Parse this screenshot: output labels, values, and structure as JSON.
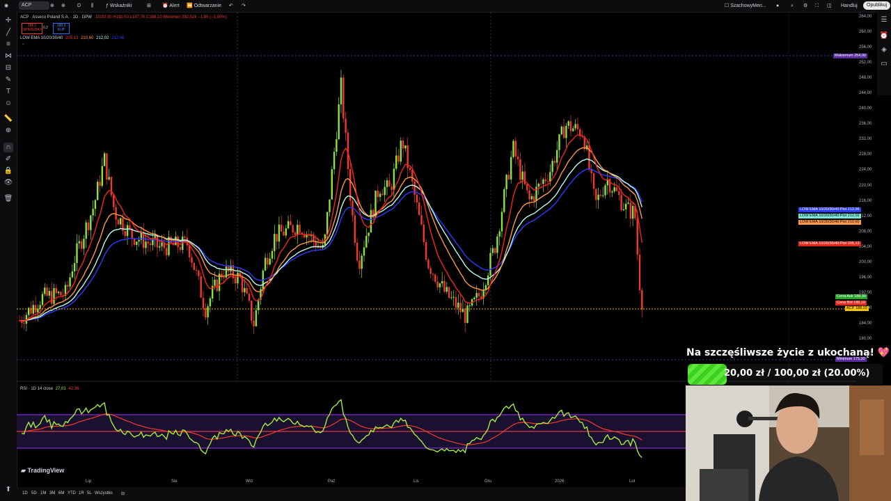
{
  "topbar": {
    "symbol": "ACP",
    "interval": "D",
    "indicators_label": "Wskaźniki",
    "alert_label": "Alert",
    "replay_label": "Odtwarzanie",
    "layout_label": "SzachowyMen...",
    "trade_label": "Handluj",
    "publish_label": "Opublikuj"
  },
  "legend": {
    "title": "ACP · Asseco Poland S.A. · 1D · GPW",
    "ohlc": "O192,00 H192,50 L187,70 C188,10 Wolumen 282,02k −1,90 (−1,00%)",
    "sell_price": "188,1",
    "sell_label": "SPRZEDAJ",
    "spread": "0,2",
    "buy_price": "188,3",
    "buy_label": "KUP",
    "ema_name": "LOW EMA 10/20/30/40",
    "ema_v1": "205,13",
    "ema_v2": "210,60",
    "ema_v3": "212,02",
    "ema_v4": "212,06",
    "rsi_name": "RSI · 1D 14 close",
    "rsi_v1": "27,01",
    "rsi_v2": "42,36"
  },
  "price_axis": [
    "264,00",
    "260,00",
    "256,00",
    "252,00",
    "248,00",
    "244,00",
    "240,00",
    "236,00",
    "232,00",
    "228,00",
    "224,00",
    "220,00",
    "216,00",
    "212,00",
    "208,00",
    "204,00",
    "200,00",
    "196,00",
    "192,00",
    "188,00",
    "184,00",
    "180,00",
    "176,00"
  ],
  "time_axis": [
    "Lip",
    "Sie",
    "Wrz",
    "Paź",
    "Lis",
    "Gru",
    "2026",
    "Lut"
  ],
  "tags": {
    "max_label": "Maksimum",
    "max_value": "254,00",
    "min_label": "Minimum",
    "min_value": "175,30",
    "ema_plot_label": "LOW EMA 10/20/30/40:Plot",
    "ema_blue": "212,06",
    "ema_cyan": "212,02",
    "ema_orange": "210,60",
    "ema_red": "205,13",
    "ask_label": "Cena Ask",
    "ask_value": "188,30",
    "bid_label": "Cena Bid",
    "bid_value": "188,10",
    "last_label": "ACP",
    "last_value": "188,10"
  },
  "ranges": [
    "1D",
    "5D",
    "1M",
    "3M",
    "6M",
    "YTD",
    "1R",
    "5L",
    "Wszystko"
  ],
  "tradingview_label": "TradingView",
  "stream": {
    "goal_title": "Na szczęśliwsze życie z ukochaną! 💖🌹",
    "goal_text": "20,00 zł / 100,00 zł (20.00%)",
    "goal_progress": 0.2
  },
  "colors": {
    "bull": "#8ee33a",
    "bear": "#f23a2c",
    "ema10": "#f5261c",
    "ema20": "#ff9a4a",
    "ema30": "#b9fff3",
    "ema40": "#2c3cff",
    "rsi": "#a4ee3b",
    "rsi_ma": "#f53a2a",
    "band": "#8e2bd6"
  }
}
